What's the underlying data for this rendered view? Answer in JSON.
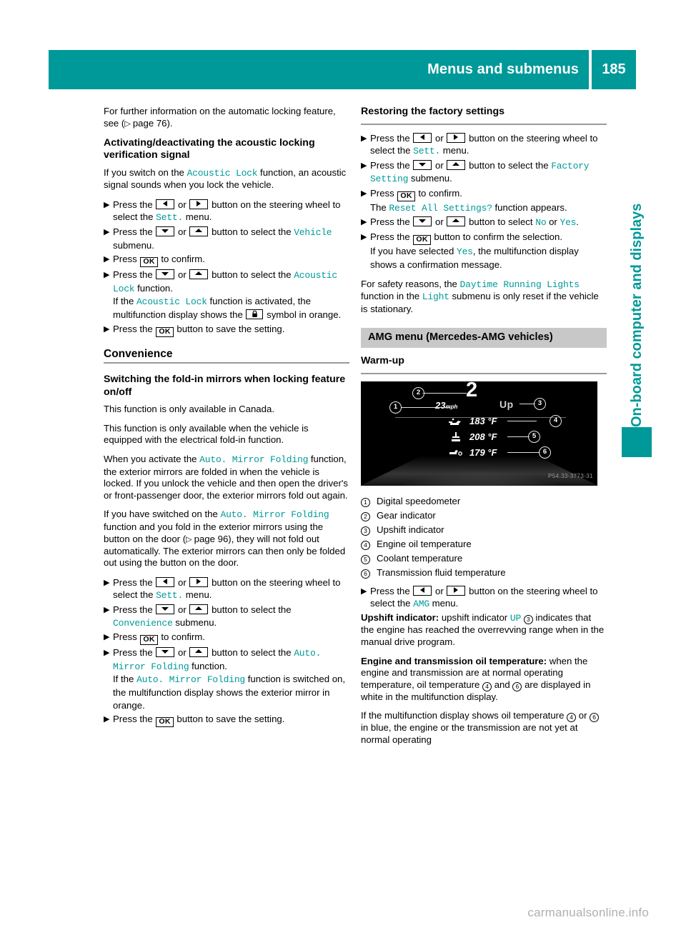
{
  "header": {
    "title": "Menus and submenus",
    "page_number": "185"
  },
  "side_tab": {
    "label": "On-board computer and displays"
  },
  "keys": {
    "left": "◀",
    "right": "▶",
    "down": "▼",
    "up": "▲",
    "ok": "OK",
    "lock": "lock-symbol"
  },
  "left_column": {
    "intro": {
      "line1": "For further information on the automatic locking feature, see (",
      "pageref": "page 76",
      "line2": ")."
    },
    "heading_acoustic": "Activating/deactivating the acoustic locking verification signal",
    "acoustic_intro": {
      "a": "If you switch on the ",
      "term": "Acoustic Lock",
      "b": " function, an acoustic signal sounds when you lock the vehicle."
    },
    "steps": [
      {
        "parts": [
          "Press the ",
          "KEY_LEFT",
          " or ",
          "KEY_RIGHT",
          " button on the steering wheel to select the ",
          "MONO:Sett.",
          " menu."
        ]
      },
      {
        "parts": [
          "Press the ",
          "KEY_DOWN",
          " or ",
          "KEY_UP",
          " button to select the ",
          "MONO:Vehicle",
          " submenu."
        ]
      },
      {
        "parts": [
          "Press ",
          "KEY_OK",
          " to confirm."
        ]
      },
      {
        "parts": [
          "Press the ",
          "KEY_DOWN",
          " or ",
          "KEY_UP",
          " button to select the ",
          "MONO:Acoustic Lock",
          " function."
        ],
        "note": [
          "If the ",
          "MONO:Acoustic Lock",
          " function is activated, the multifunction display shows the ",
          "KEY_LOCK",
          " symbol in orange."
        ]
      },
      {
        "parts": [
          "Press the ",
          "KEY_OK",
          " button to save the setting."
        ]
      }
    ],
    "section_convenience": "Convenience",
    "heading_mirrors": "Switching the fold-in mirrors when locking feature on/off",
    "p1": "This function is only available in Canada.",
    "p2": "This function is only available when the vehicle is equipped with the electrical fold-in function.",
    "p3": {
      "a": "When you activate the ",
      "term": "Auto. Mirror Folding",
      "b": " function, the exterior mirrors are folded in when the vehicle is locked. If you unlock the vehicle and then open the driver's or front-passenger door, the exterior mirrors fold out again."
    },
    "p4": {
      "a": "If you have switched on the ",
      "term": "Auto. Mirror Folding",
      "b": " function and you fold in the exterior mirrors using the button on the door (",
      "pageref": "page 96",
      "c": "), they will not fold out automatically. The exterior mirrors can then only be folded out using the button on the door."
    },
    "steps2": [
      {
        "parts": [
          "Press the ",
          "KEY_LEFT",
          " or ",
          "KEY_RIGHT",
          " button on the steering wheel to select the ",
          "MONO:Sett.",
          " menu."
        ]
      },
      {
        "parts": [
          "Press the ",
          "KEY_DOWN",
          " or ",
          "KEY_UP",
          " button to select the ",
          "MONO:Convenience",
          " submenu."
        ]
      },
      {
        "parts": [
          "Press ",
          "KEY_OK",
          " to confirm."
        ]
      },
      {
        "parts": [
          "Press the ",
          "KEY_DOWN",
          " or ",
          "KEY_UP",
          " button to select the ",
          "MONO:Auto. Mirror Folding",
          " function."
        ],
        "note": [
          "If the ",
          "MONO:Auto. Mirror Folding",
          " function is switched on, the multifunction display shows the exterior mirror in orange."
        ]
      },
      {
        "parts": [
          "Press the ",
          "KEY_OK",
          " button to save the setting."
        ]
      }
    ]
  },
  "right_column": {
    "heading_factory": "Restoring the factory settings",
    "steps": [
      {
        "parts": [
          "Press the ",
          "KEY_LEFT",
          " or ",
          "KEY_RIGHT",
          " button on the steering wheel to select the ",
          "MONO:Sett.",
          " menu."
        ]
      },
      {
        "parts": [
          "Press the ",
          "KEY_DOWN",
          " or ",
          "KEY_UP",
          " button to select the ",
          "MONO:Factory Setting",
          " submenu."
        ]
      },
      {
        "parts": [
          "Press ",
          "KEY_OK",
          " to confirm."
        ],
        "note": [
          "The ",
          "MONO:Reset All Settings?",
          " function appears."
        ]
      },
      {
        "parts": [
          "Press the ",
          "KEY_DOWN",
          " or ",
          "KEY_UP",
          " button to select ",
          "MONO:No",
          " or ",
          "MONO:Yes",
          "."
        ]
      },
      {
        "parts": [
          "Press the ",
          "KEY_OK",
          " button to confirm the selection."
        ],
        "note": [
          "If you have selected ",
          "MONO:Yes",
          ", the multifunction display shows a confirmation message."
        ]
      }
    ],
    "safety_note": {
      "a": "For safety reasons, the ",
      "term1": "Daytime Running Lights",
      "b": " function in the ",
      "term2": "Light",
      "c": " submenu is only reset if the vehicle is stationary."
    },
    "banner_amg": "AMG menu (Mercedes-AMG vehicles)",
    "heading_warmup": "Warm-up",
    "figure": {
      "gear": "2",
      "speed": "23",
      "speed_unit": "mph",
      "upshift": "Up",
      "oil_temp": "183 °F",
      "coolant_temp": "208 °F",
      "trans_temp": "179 °F",
      "code": "P54.33-3773-31",
      "callouts": [
        "1",
        "2",
        "3",
        "4",
        "5",
        "6"
      ]
    },
    "legend": [
      {
        "num": "1",
        "label": "Digital speedometer"
      },
      {
        "num": "2",
        "label": "Gear indicator"
      },
      {
        "num": "3",
        "label": "Upshift indicator"
      },
      {
        "num": "4",
        "label": "Engine oil temperature"
      },
      {
        "num": "5",
        "label": "Coolant temperature"
      },
      {
        "num": "6",
        "label": "Transmission fluid temperature"
      }
    ],
    "final_step": {
      "parts": [
        "Press the ",
        "KEY_LEFT",
        " or ",
        "KEY_RIGHT",
        " button on the steering wheel to select the ",
        "MONO:AMG",
        " menu."
      ],
      "upshift_label": "Upshift indicator:",
      "upshift_text_a": " upshift indicator ",
      "upshift_term": "UP",
      "upshift_circ": "3",
      "upshift_text_b": " indicates that the engine has reached the overrevving range when in the manual drive program.",
      "oil_label": "Engine and transmission oil temperature:",
      "oil_text_a": " when the engine and transmission are at normal operating temperature, oil temperature ",
      "oil_circ_1": "4",
      "oil_text_b": " and ",
      "oil_circ_2": "6",
      "oil_text_c": " are displayed in white in the multifunction display.",
      "blue_text_a": "If the multifunction display shows oil temperature ",
      "blue_circ_1": "4",
      "blue_text_b": " or ",
      "blue_circ_2": "6",
      "blue_text_c": " in blue, the engine or the transmission are not yet at normal operating"
    }
  },
  "footer": {
    "watermark": "carmanualsonline.info"
  },
  "colors": {
    "accent": "#009999",
    "banner": "#c8c8c8",
    "rule": "#9a9a9a"
  }
}
